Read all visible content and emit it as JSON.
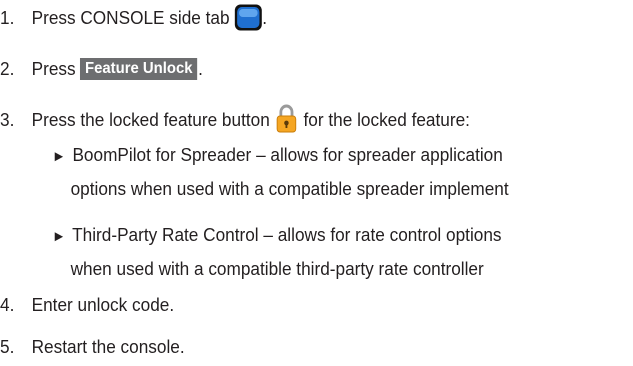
{
  "steps": [
    {
      "num": "1.",
      "text_before": "Press CONSOLE side tab",
      "text_after": ".",
      "icon": "console-tab-icon"
    },
    {
      "num": "2.",
      "text_before": "Press",
      "button_label": "Feature Unlock",
      "text_after": "."
    },
    {
      "num": "3.",
      "text_before": "Press the locked feature button",
      "text_after": " for the locked feature:",
      "icon": "padlock-icon"
    },
    {
      "num": "4.",
      "text": "Enter unlock code."
    },
    {
      "num": "5.",
      "text": "Restart the console."
    }
  ],
  "bullets": [
    {
      "marker": "►",
      "lines": [
        "BoomPilot for Spreader – allows for spreader application",
        "options when used with a compatible spreader implement"
      ]
    },
    {
      "marker": "►",
      "lines": [
        "Third-Party Rate Control – allows for rate control options",
        "when used with a compatible third-party rate controller"
      ]
    }
  ],
  "colors": {
    "text": "#231f20",
    "button_bg": "#6d6e70",
    "icon_blue": "#1f6fd0",
    "lock_gold": "#f5a623"
  }
}
